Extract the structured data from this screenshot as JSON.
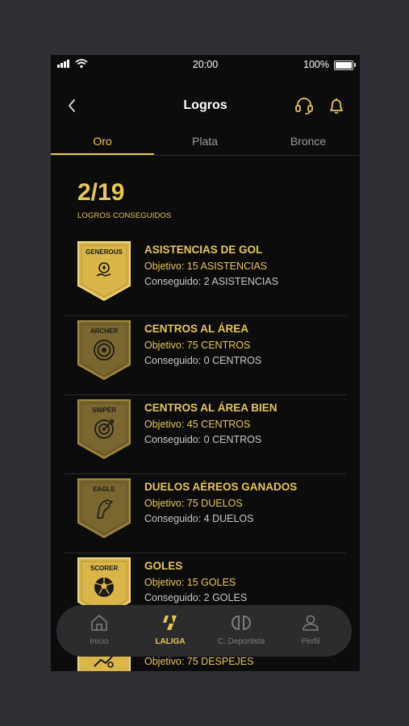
{
  "status": {
    "time": "20:00",
    "battery": "100%"
  },
  "header": {
    "title": "Logros"
  },
  "tabs": [
    {
      "label": "Oro"
    },
    {
      "label": "Plata"
    },
    {
      "label": "Bronce"
    }
  ],
  "summary": {
    "count": "2/19",
    "label": "LOGROS CONSEGUIDOS"
  },
  "achievements": [
    {
      "badge": "GENEROUS",
      "name": "ASISTENCIAS DE GOL",
      "goal": "Objetivo: 15 ASISTENCIAS",
      "done": "Conseguido: 2 ASISTENCIAS",
      "icon": "ball-hand-icon"
    },
    {
      "badge": "ARCHER",
      "name": "CENTROS AL ÁREA",
      "goal": "Objetivo: 75 CENTROS",
      "done": "Conseguido: 0 CENTROS",
      "icon": "target-icon"
    },
    {
      "badge": "SNIPER",
      "name": "CENTROS AL ÁREA BIEN",
      "goal": "Objetivo: 45 CENTROS",
      "done": "Conseguido: 0 CENTROS",
      "icon": "crosshair-icon"
    },
    {
      "badge": "EAGLE",
      "name": "DUELOS AÉREOS GANADOS",
      "goal": "Objetivo: 75 DUELOS",
      "done": "Conseguido: 4 DUELOS",
      "icon": "eagle-icon"
    },
    {
      "badge": "SCORER",
      "name": "GOLES",
      "goal": "Objetivo: 15 GOLES",
      "done": "Conseguido: 2 GOLES",
      "icon": "soccer-ball-icon"
    },
    {
      "badge": "",
      "name": "",
      "goal": "Objetivo: 75 DESPEJES",
      "done": "",
      "icon": "kick-icon"
    }
  ],
  "nav": [
    {
      "label": "Inicio"
    },
    {
      "label": "LALIGA"
    },
    {
      "label": "C. Deportista"
    },
    {
      "label": "Perfil"
    }
  ],
  "colors": {
    "gold": "#e7c65a",
    "badge_gold": "#d9b54a",
    "badge_dark": "#7a6730",
    "background": "#0c0c0d"
  }
}
